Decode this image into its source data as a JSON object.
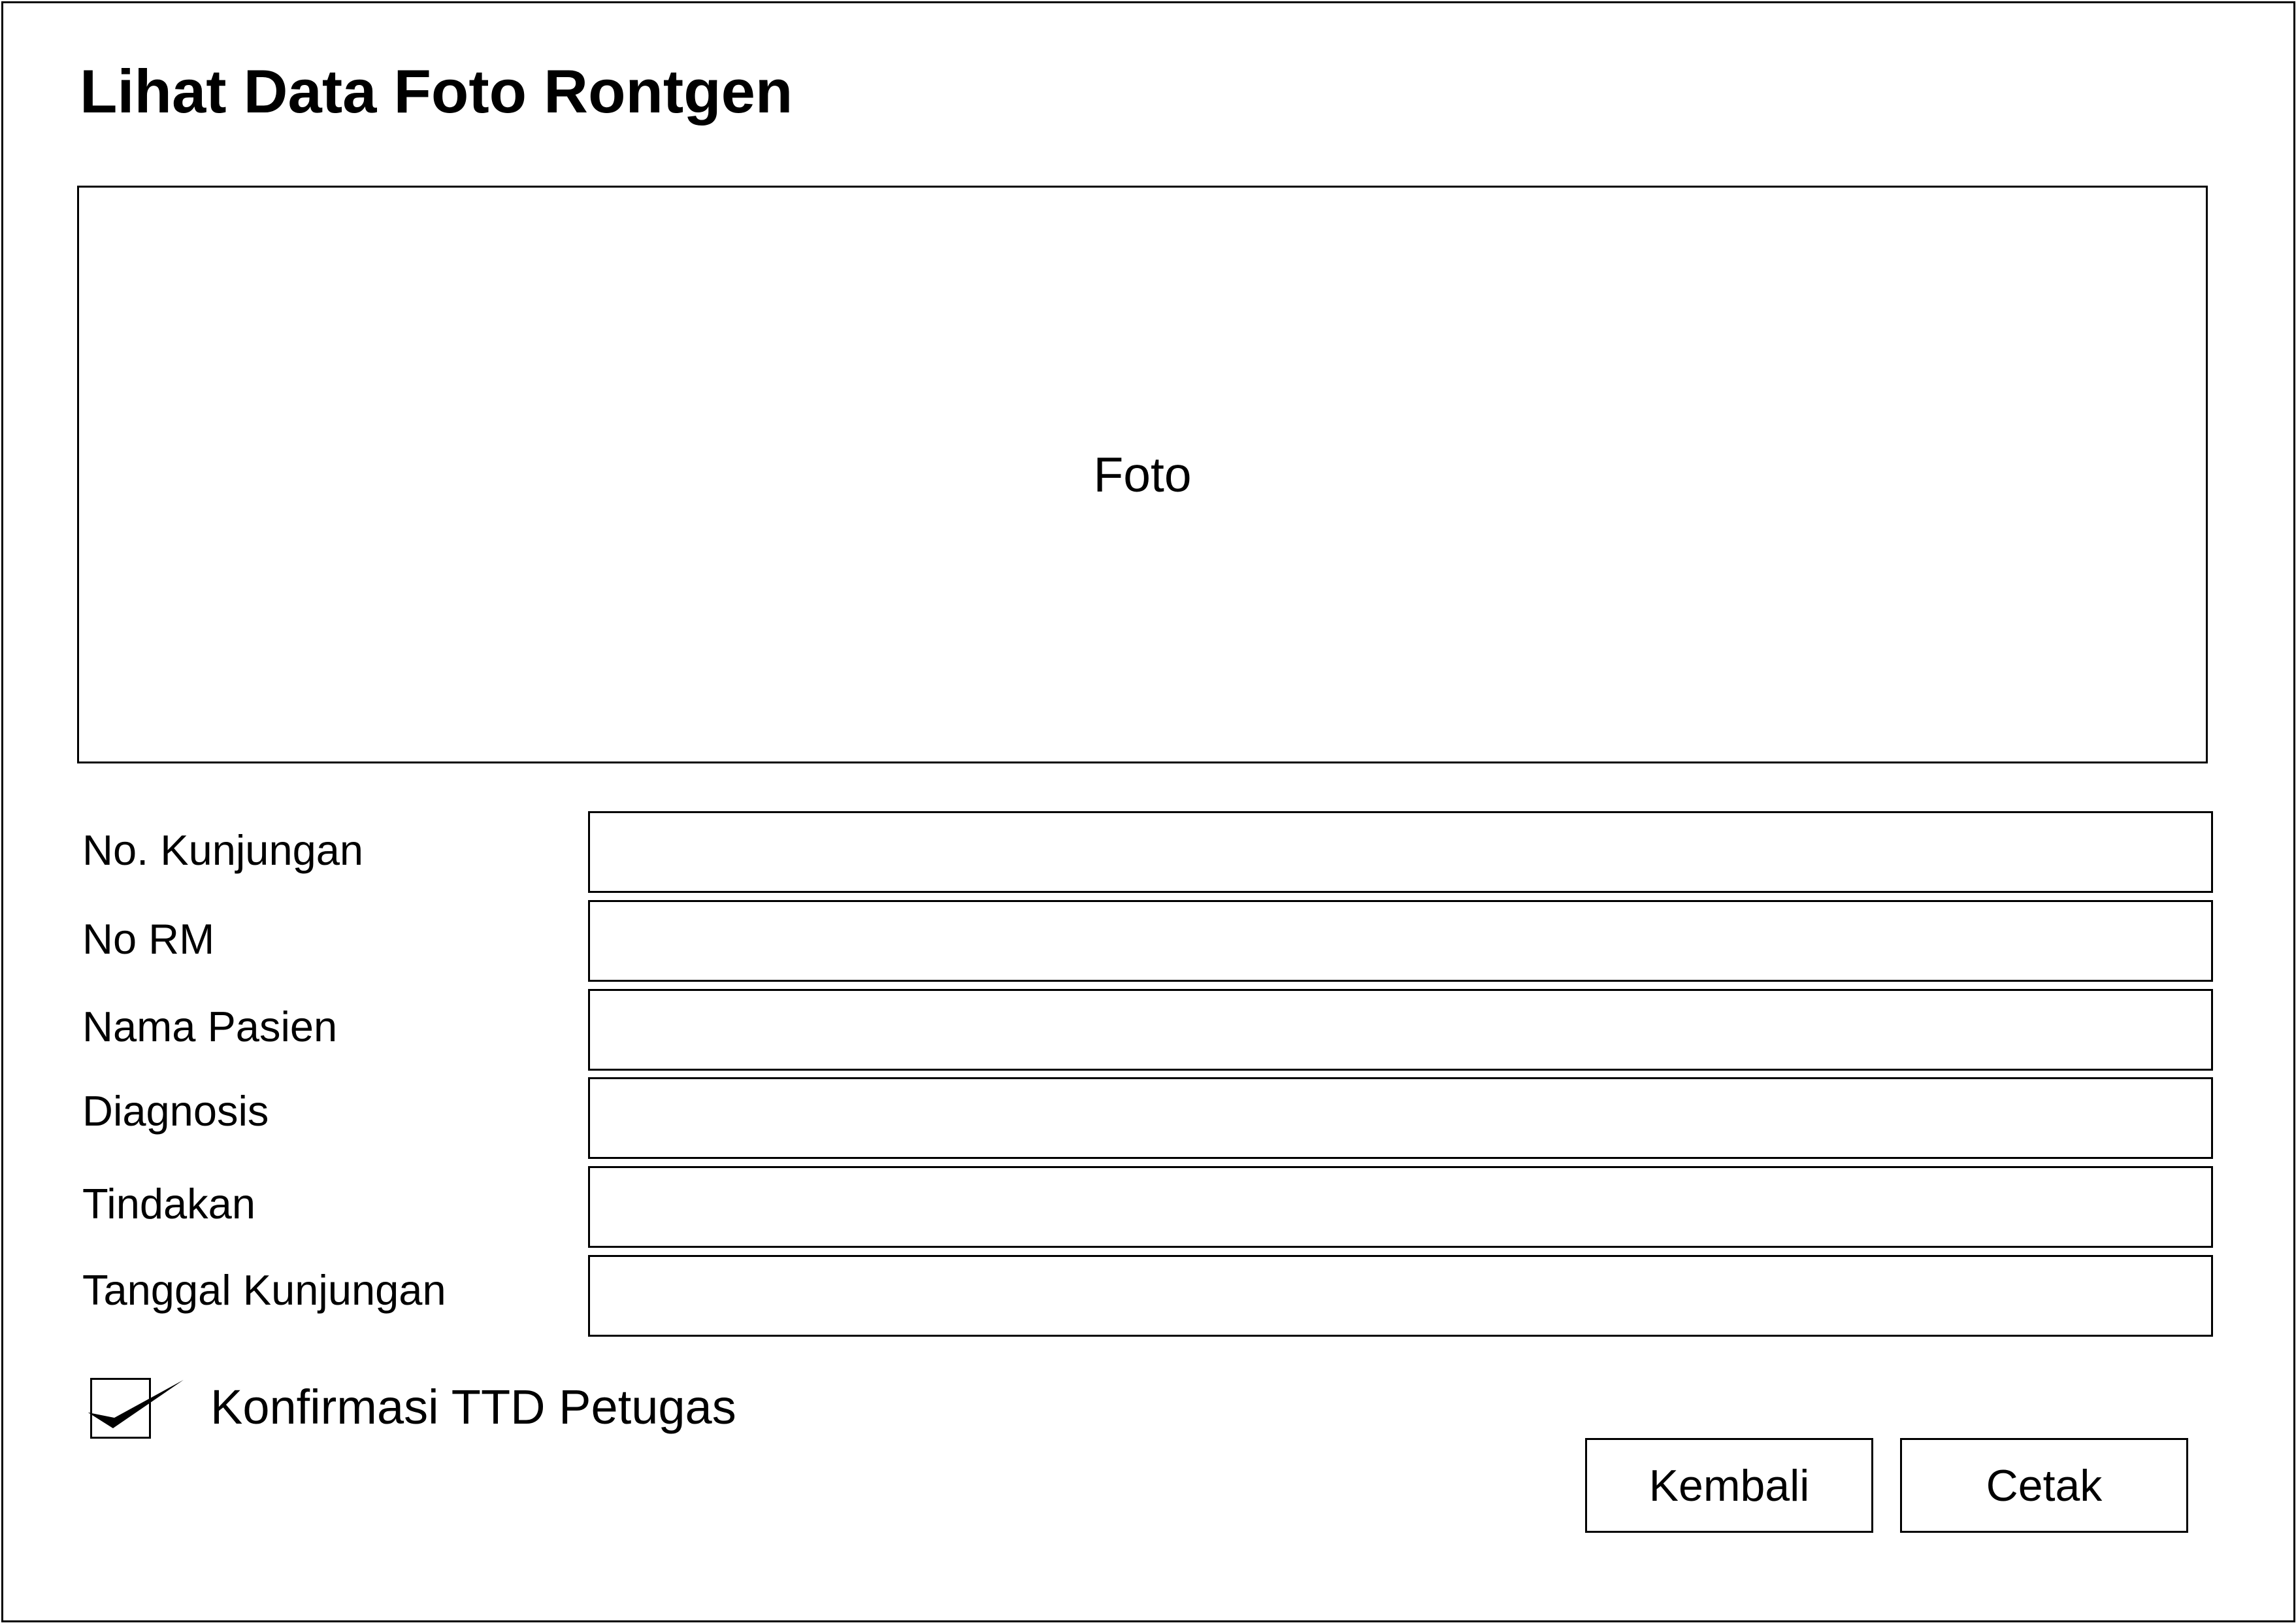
{
  "window": {
    "title": "Lihat Data Foto Rontgen"
  },
  "photo": {
    "label": "Foto"
  },
  "form": {
    "fields": [
      {
        "label": "No. Kunjungan",
        "value": ""
      },
      {
        "label": "No RM",
        "value": ""
      },
      {
        "label": "Nama Pasien",
        "value": ""
      },
      {
        "label": "Diagnosis",
        "value": ""
      },
      {
        "label": "Tindakan",
        "value": ""
      },
      {
        "label": "Tanggal Kunjungan",
        "value": ""
      }
    ]
  },
  "confirmation": {
    "label": "Konfirmasi TTD Petugas",
    "checked": true
  },
  "actions": {
    "back_label": "Kembali",
    "print_label": "Cetak"
  },
  "icons": {
    "checkbox": "checkmark-icon"
  }
}
